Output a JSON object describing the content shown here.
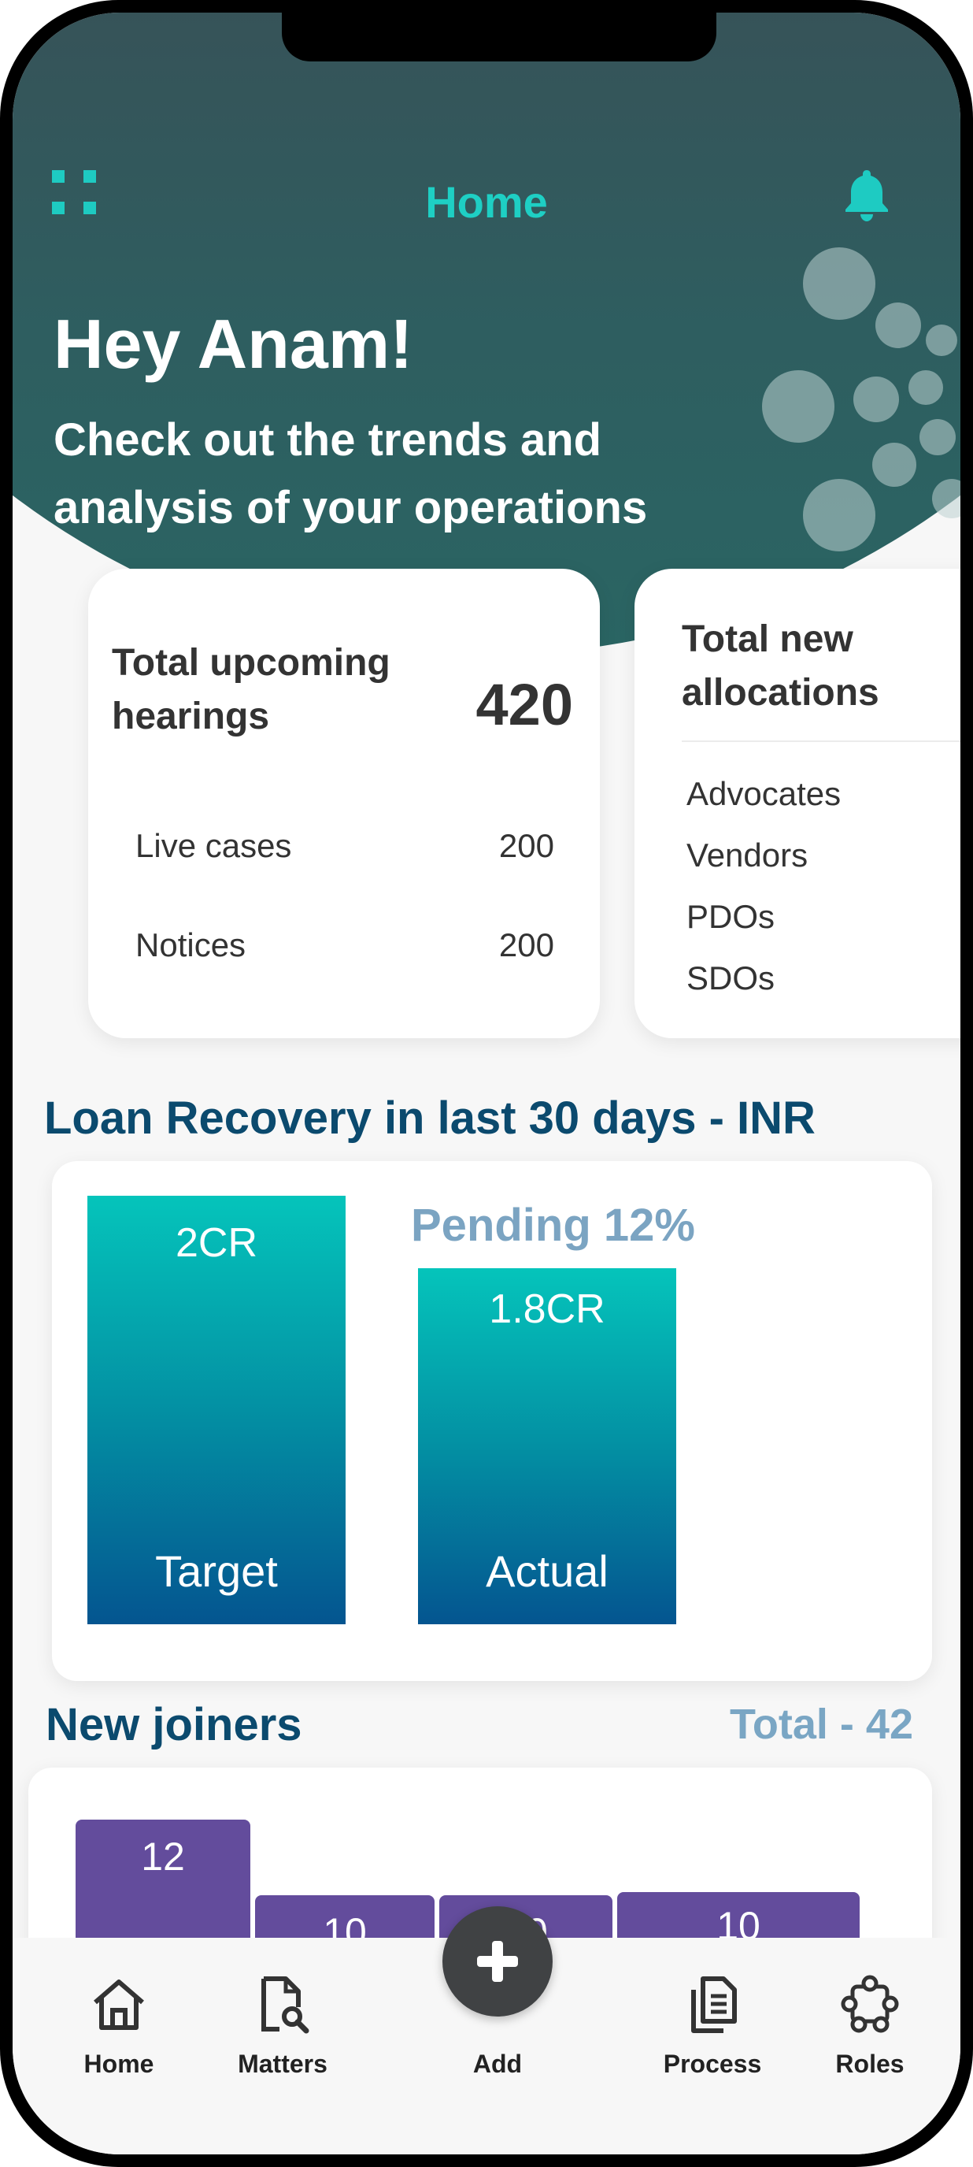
{
  "header": {
    "title": "Home",
    "greeting": "Hey Anam!",
    "subtitle": "Check out the trends and analysis of your operations"
  },
  "cards": {
    "upcoming": {
      "title": "Total upcoming hearings",
      "total": "420",
      "rows": [
        {
          "label": "Live cases",
          "value": "200"
        },
        {
          "label": "Notices",
          "value": "200"
        }
      ]
    },
    "allocations": {
      "title": "Total new allocations",
      "items": [
        "Advocates",
        "Vendors",
        "PDOs",
        "SDOs"
      ]
    }
  },
  "loan": {
    "title": "Loan Recovery in last 30 days - INR",
    "pending": "Pending 12%",
    "target_value": "2CR",
    "target_label": "Target",
    "actual_value": "1.8CR",
    "actual_label": "Actual"
  },
  "joiners": {
    "title": "New joiners",
    "total": "Total - 42",
    "bars": [
      "12",
      "10",
      "10",
      "10"
    ]
  },
  "nav": {
    "home": "Home",
    "matters": "Matters",
    "add": "Add",
    "process": "Process",
    "roles": "Roles"
  },
  "colors": {
    "accent": "#1ecfc4",
    "header_dark": "#394f56",
    "navy": "#0b4a6e",
    "purple": "#634c9c"
  },
  "chart_data": [
    {
      "type": "bar",
      "title": "Loan Recovery in last 30 days - INR",
      "categories": [
        "Target",
        "Actual"
      ],
      "values": [
        2.0,
        1.8
      ],
      "value_labels": [
        "2CR",
        "1.8CR"
      ],
      "annotation": "Pending 12%"
    },
    {
      "type": "bar",
      "title": "New joiners",
      "values": [
        12,
        10,
        10,
        10
      ],
      "annotation": "Total - 42"
    }
  ]
}
